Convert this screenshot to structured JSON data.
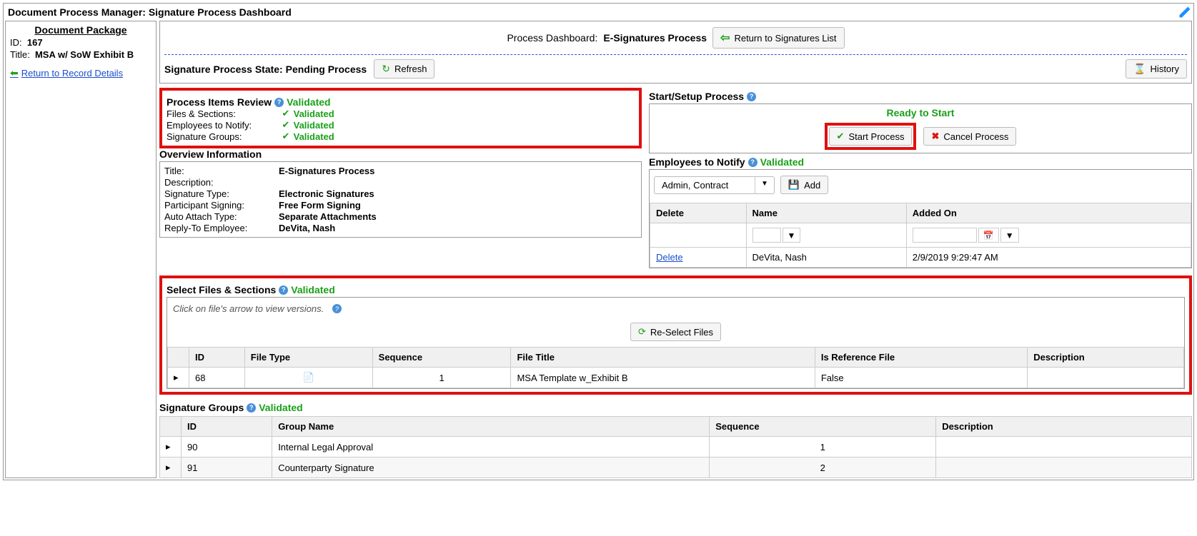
{
  "titleBar": "Document Process Manager: Signature Process Dashboard",
  "package": {
    "heading": "Document Package",
    "idLabel": "ID:",
    "id": "167",
    "titleLabel": "Title:",
    "title": "MSA w/ SoW Exhibit B",
    "backLink": "Return to Record Details"
  },
  "dashboard": {
    "label": "Process Dashboard:",
    "name": "E-Signatures Process",
    "returnBtn": "Return to Signatures List",
    "stateLabel": "Signature Process State: Pending Process",
    "refreshBtn": "Refresh",
    "historyBtn": "History"
  },
  "review": {
    "title": "Process Items Review",
    "status": "Validated",
    "items": [
      {
        "label": "Files & Sections:",
        "status": "Validated"
      },
      {
        "label": "Employees to Notify:",
        "status": "Validated"
      },
      {
        "label": "Signature Groups:",
        "status": "Validated"
      }
    ]
  },
  "overview": {
    "title": "Overview Information",
    "rows": [
      {
        "k": "Title:",
        "v": "E-Signatures Process"
      },
      {
        "k": "Description:",
        "v": ""
      },
      {
        "k": "Signature Type:",
        "v": "Electronic Signatures"
      },
      {
        "k": "Participant Signing:",
        "v": "Free Form Signing"
      },
      {
        "k": "Auto Attach Type:",
        "v": "Separate Attachments"
      },
      {
        "k": "Reply-To Employee:",
        "v": "DeVita, Nash"
      }
    ]
  },
  "setup": {
    "title": "Start/Setup Process",
    "ready": "Ready to Start",
    "startBtn": "Start Process",
    "cancelBtn": "Cancel Process"
  },
  "notify": {
    "title": "Employees to Notify",
    "status": "Validated",
    "selectVal": "Admin, Contract",
    "addBtn": "Add",
    "cols": {
      "del": "Delete",
      "name": "Name",
      "added": "Added On"
    },
    "rows": [
      {
        "del": "Delete",
        "name": "DeVita, Nash",
        "added": "2/9/2019 9:29:47 AM"
      }
    ]
  },
  "files": {
    "title": "Select Files & Sections",
    "status": "Validated",
    "hint": "Click on file's arrow to view versions.",
    "reselectBtn": "Re-Select Files",
    "cols": {
      "id": "ID",
      "type": "File Type",
      "seq": "Sequence",
      "ftitle": "File Title",
      "ref": "Is Reference File",
      "desc": "Description"
    },
    "rows": [
      {
        "id": "68",
        "type": "pdf",
        "seq": "1",
        "ftitle": "MSA Template w_Exhibit B",
        "ref": "False",
        "desc": ""
      }
    ]
  },
  "groups": {
    "title": "Signature Groups",
    "status": "Validated",
    "cols": {
      "id": "ID",
      "name": "Group Name",
      "seq": "Sequence",
      "desc": "Description"
    },
    "rows": [
      {
        "id": "90",
        "name": "Internal Legal Approval",
        "seq": "1",
        "desc": ""
      },
      {
        "id": "91",
        "name": "Counterparty Signature",
        "seq": "2",
        "desc": ""
      }
    ]
  }
}
